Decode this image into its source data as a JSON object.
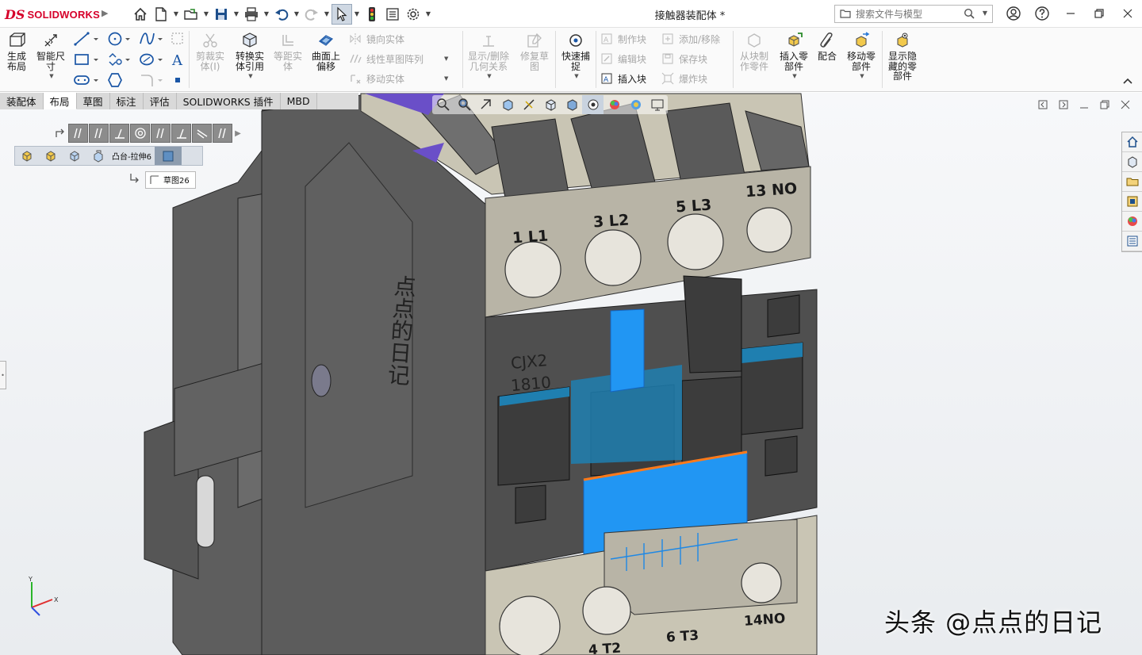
{
  "app": {
    "logo_mark": "DS",
    "logo_text": "SOLIDWORKS",
    "document_title": "接触器装配体 *"
  },
  "search": {
    "placeholder": "搜索文件与模型"
  },
  "ribbon": {
    "big": [
      {
        "id": "generate-layout",
        "label": "生成\n布局"
      },
      {
        "id": "smart-dimension",
        "label": "智能尺\n寸"
      },
      {
        "id": "trim-entities",
        "label": "剪裁实\n体(I)"
      },
      {
        "id": "convert-entities",
        "label": "转换实\n体引用"
      },
      {
        "id": "offset-entities",
        "label": "等距实\n体"
      },
      {
        "id": "offset-on-surface",
        "label": "曲面上\n偏移"
      },
      {
        "id": "display-delete-relations",
        "label": "显示/删除\n几何关系"
      },
      {
        "id": "repair-sketch",
        "label": "修复草\n图"
      },
      {
        "id": "quick-snaps",
        "label": "快速捕\n捉"
      },
      {
        "id": "make-part-from-block",
        "label": "从块制\n作零件"
      },
      {
        "id": "insert-components",
        "label": "插入零\n部件"
      },
      {
        "id": "mate",
        "label": "配合"
      },
      {
        "id": "move-component",
        "label": "移动零\n部件"
      },
      {
        "id": "show-hidden-components",
        "label": "显示隐\n藏的零\n部件"
      }
    ],
    "small": {
      "mirror_entities": "镜向实体",
      "linear_pattern": "线性草图阵列",
      "move_entities": "移动实体",
      "make_block": "制作块",
      "edit_block": "编辑块",
      "insert_block": "插入块",
      "add_remove": "添加/移除",
      "save_block": "保存块",
      "explode_block": "爆炸块"
    }
  },
  "tabs": [
    "装配体",
    "布局",
    "草图",
    "标注",
    "评估",
    "SOLIDWORKS 插件",
    "MBD"
  ],
  "active_tab": "布局",
  "breadcrumb": {
    "feature_label": "凸台-拉伸6",
    "sketch_label": "草图26"
  },
  "model": {
    "side_text": "点点的日记",
    "terminals_top": [
      "1 L1",
      "3 L2",
      "5 L3",
      "13 NO"
    ],
    "terminals_bottom": [
      "4 T2",
      "6 T3",
      "14NO"
    ],
    "model_code_1": "CJX2",
    "model_code_2": "1810"
  },
  "triad": {
    "x": "X",
    "y": "Y"
  },
  "watermark": "头条 @点点的日记",
  "colors": {
    "brand": "#d6002a",
    "body_gray": "#5a5a5a",
    "terminal_beige": "#b8b4a6",
    "highlight_blue": "#2196f3",
    "coil_teal": "#1f7fb0",
    "edge_orange": "#ff7a1a"
  }
}
